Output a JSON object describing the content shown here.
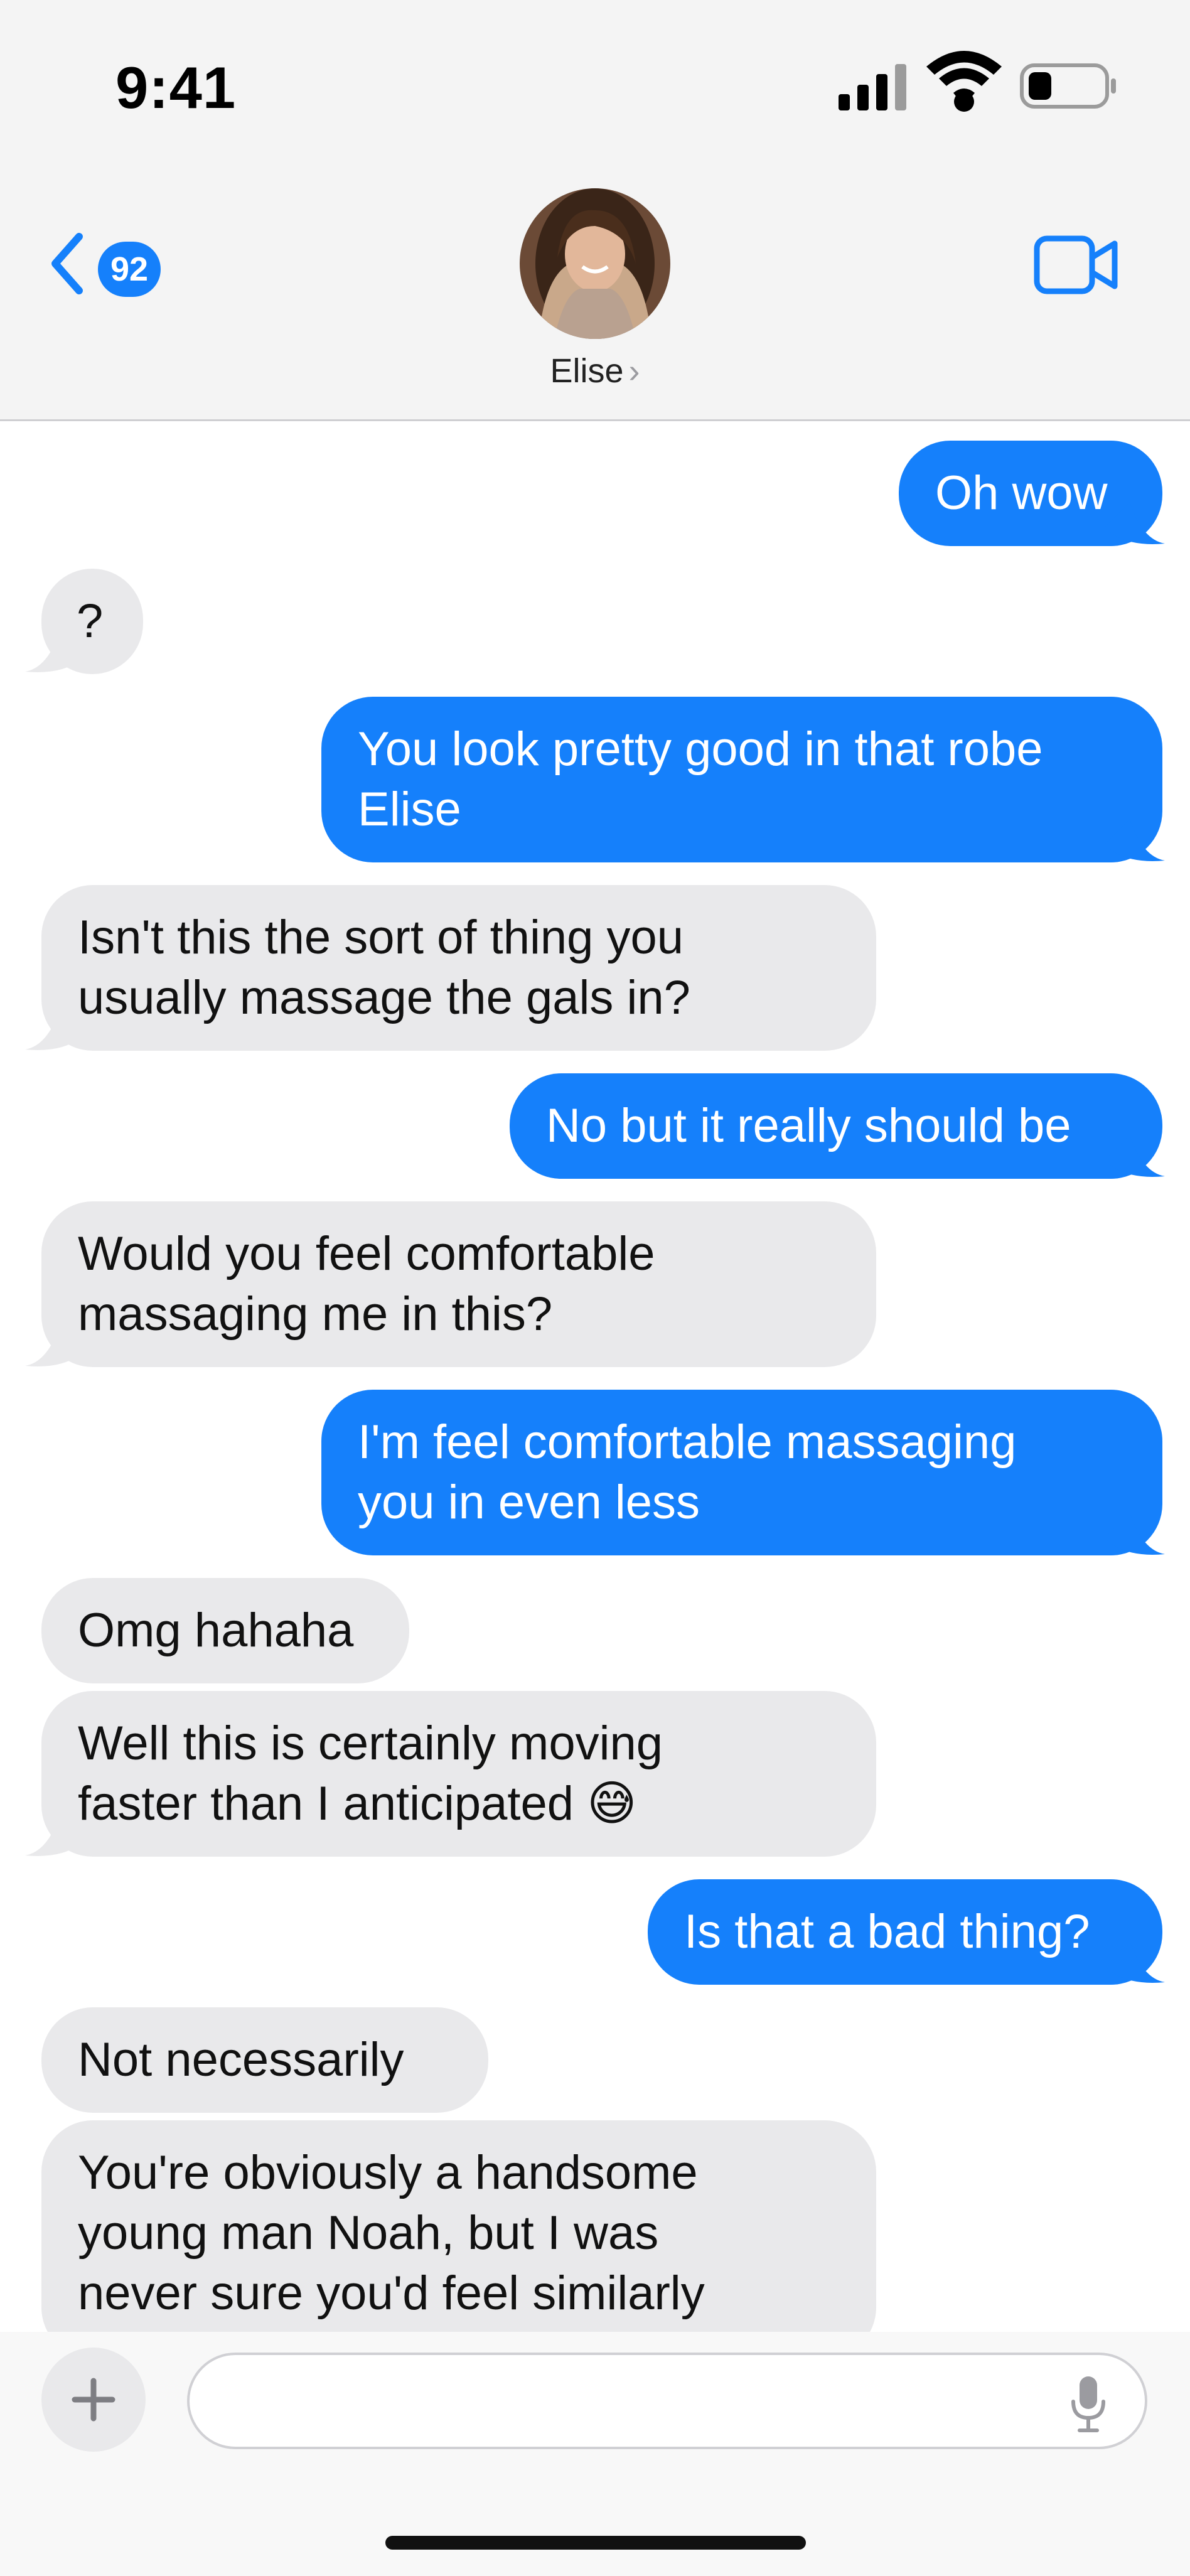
{
  "status_bar": {
    "time": "9:41",
    "battery_level": 0.3
  },
  "header": {
    "back_badge": "92",
    "contact_name": "Elise",
    "name_chevron": "›",
    "back_icon": "chevron-left-icon",
    "video_icon": "video-camera-icon"
  },
  "messages": [
    {
      "from": "me",
      "text": "Oh wow"
    },
    {
      "from": "them",
      "text": "?"
    },
    {
      "from": "me",
      "lines": [
        "You look pretty good in that robe",
        "Elise"
      ]
    },
    {
      "from": "them",
      "lines": [
        "Isn't this the sort of thing you",
        "usually massage the gals in?"
      ]
    },
    {
      "from": "me",
      "text": "No but it really should be"
    },
    {
      "from": "them",
      "lines": [
        "Would you feel comfortable",
        "massaging me in this?"
      ]
    },
    {
      "from": "me",
      "lines": [
        "I'm feel comfortable massaging",
        "you in even less"
      ]
    },
    {
      "from": "them",
      "text": "Omg hahaha"
    },
    {
      "from": "them",
      "lines": [
        "Well this is certainly moving",
        "faster than I anticipated 😅"
      ]
    },
    {
      "from": "me",
      "text": "Is that a bad thing?"
    },
    {
      "from": "them",
      "text": "Not necessarily"
    },
    {
      "from": "them",
      "lines": [
        "You're obviously a handsome",
        "young man Noah, but I was",
        "never sure you'd feel similarly"
      ]
    }
  ],
  "composer": {
    "placeholder": "",
    "plus_icon": "plus-icon",
    "mic_icon": "microphone-icon"
  },
  "colors": {
    "outgoing": "#1580fb",
    "incoming": "#e9e9eb",
    "header_bg": "#f4f4f4"
  }
}
